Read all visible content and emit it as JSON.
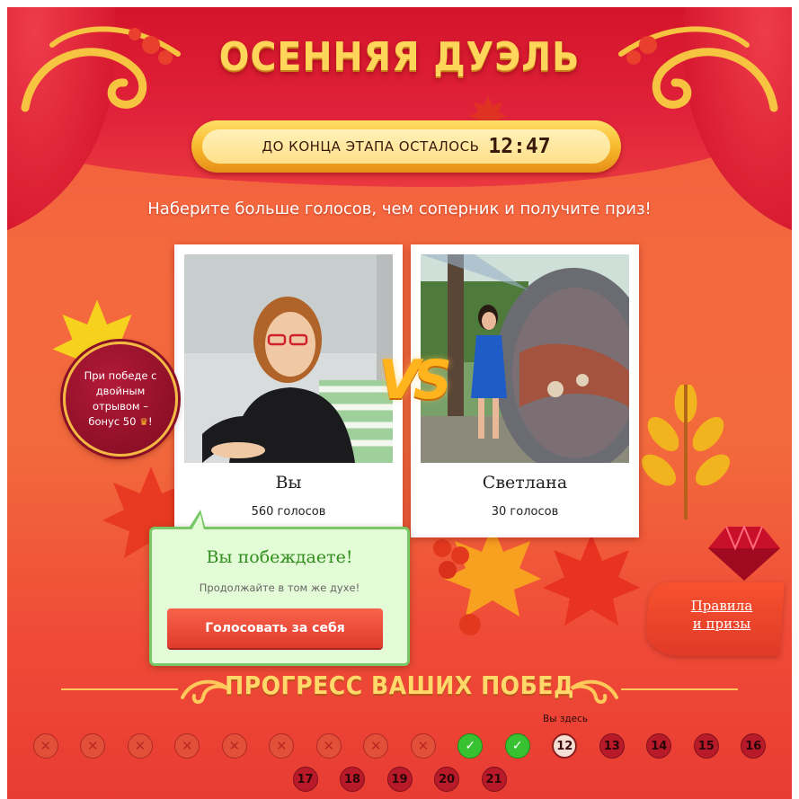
{
  "title": "ОСЕННЯЯ ДУЭЛЬ",
  "timer": {
    "label": "ДО КОНЦА ЭТАПА ОСТАЛОСЬ",
    "value": "12:47"
  },
  "subtitle": "Наберите больше голосов, чем соперник и получите приз!",
  "bonus": {
    "text": "При победе с двойным отрывом – бонус 50",
    "suffix": "!",
    "icon": "crown-icon"
  },
  "players": [
    {
      "name": "Вы",
      "votes": "560 голосов"
    },
    {
      "name": "Светлана",
      "votes": "30 голосов"
    }
  ],
  "vs_text": "VS",
  "status": {
    "title": "Вы побеждаете!",
    "text": "Продолжайте в том же духе!",
    "button": "Голосовать за себя"
  },
  "rules_link": {
    "line1": "Правила",
    "line2": "и призы"
  },
  "progress": {
    "title": "ПРОГРЕСС ВАШИХ ПОБЕД",
    "current_label": "Вы здесь",
    "steps": [
      {
        "state": "lost",
        "label": ""
      },
      {
        "state": "lost",
        "label": ""
      },
      {
        "state": "lost",
        "label": ""
      },
      {
        "state": "lost",
        "label": ""
      },
      {
        "state": "lost",
        "label": ""
      },
      {
        "state": "lost",
        "label": ""
      },
      {
        "state": "lost",
        "label": ""
      },
      {
        "state": "lost",
        "label": ""
      },
      {
        "state": "lost",
        "label": ""
      },
      {
        "state": "won",
        "label": ""
      },
      {
        "state": "won",
        "label": ""
      },
      {
        "state": "current",
        "label": "12"
      },
      {
        "state": "future",
        "label": "13"
      },
      {
        "state": "future",
        "label": "14"
      },
      {
        "state": "future",
        "label": "15"
      },
      {
        "state": "future",
        "label": "16"
      },
      {
        "state": "future",
        "label": "17"
      },
      {
        "state": "future",
        "label": "18"
      },
      {
        "state": "future",
        "label": "19"
      },
      {
        "state": "future",
        "label": "20"
      },
      {
        "state": "future",
        "label": "21"
      }
    ]
  },
  "colors": {
    "background": "#f26a3c",
    "drape": "#d81a30",
    "gold": "#ffd65a",
    "win_green": "#38c232",
    "button_red": "#e03a2c"
  }
}
